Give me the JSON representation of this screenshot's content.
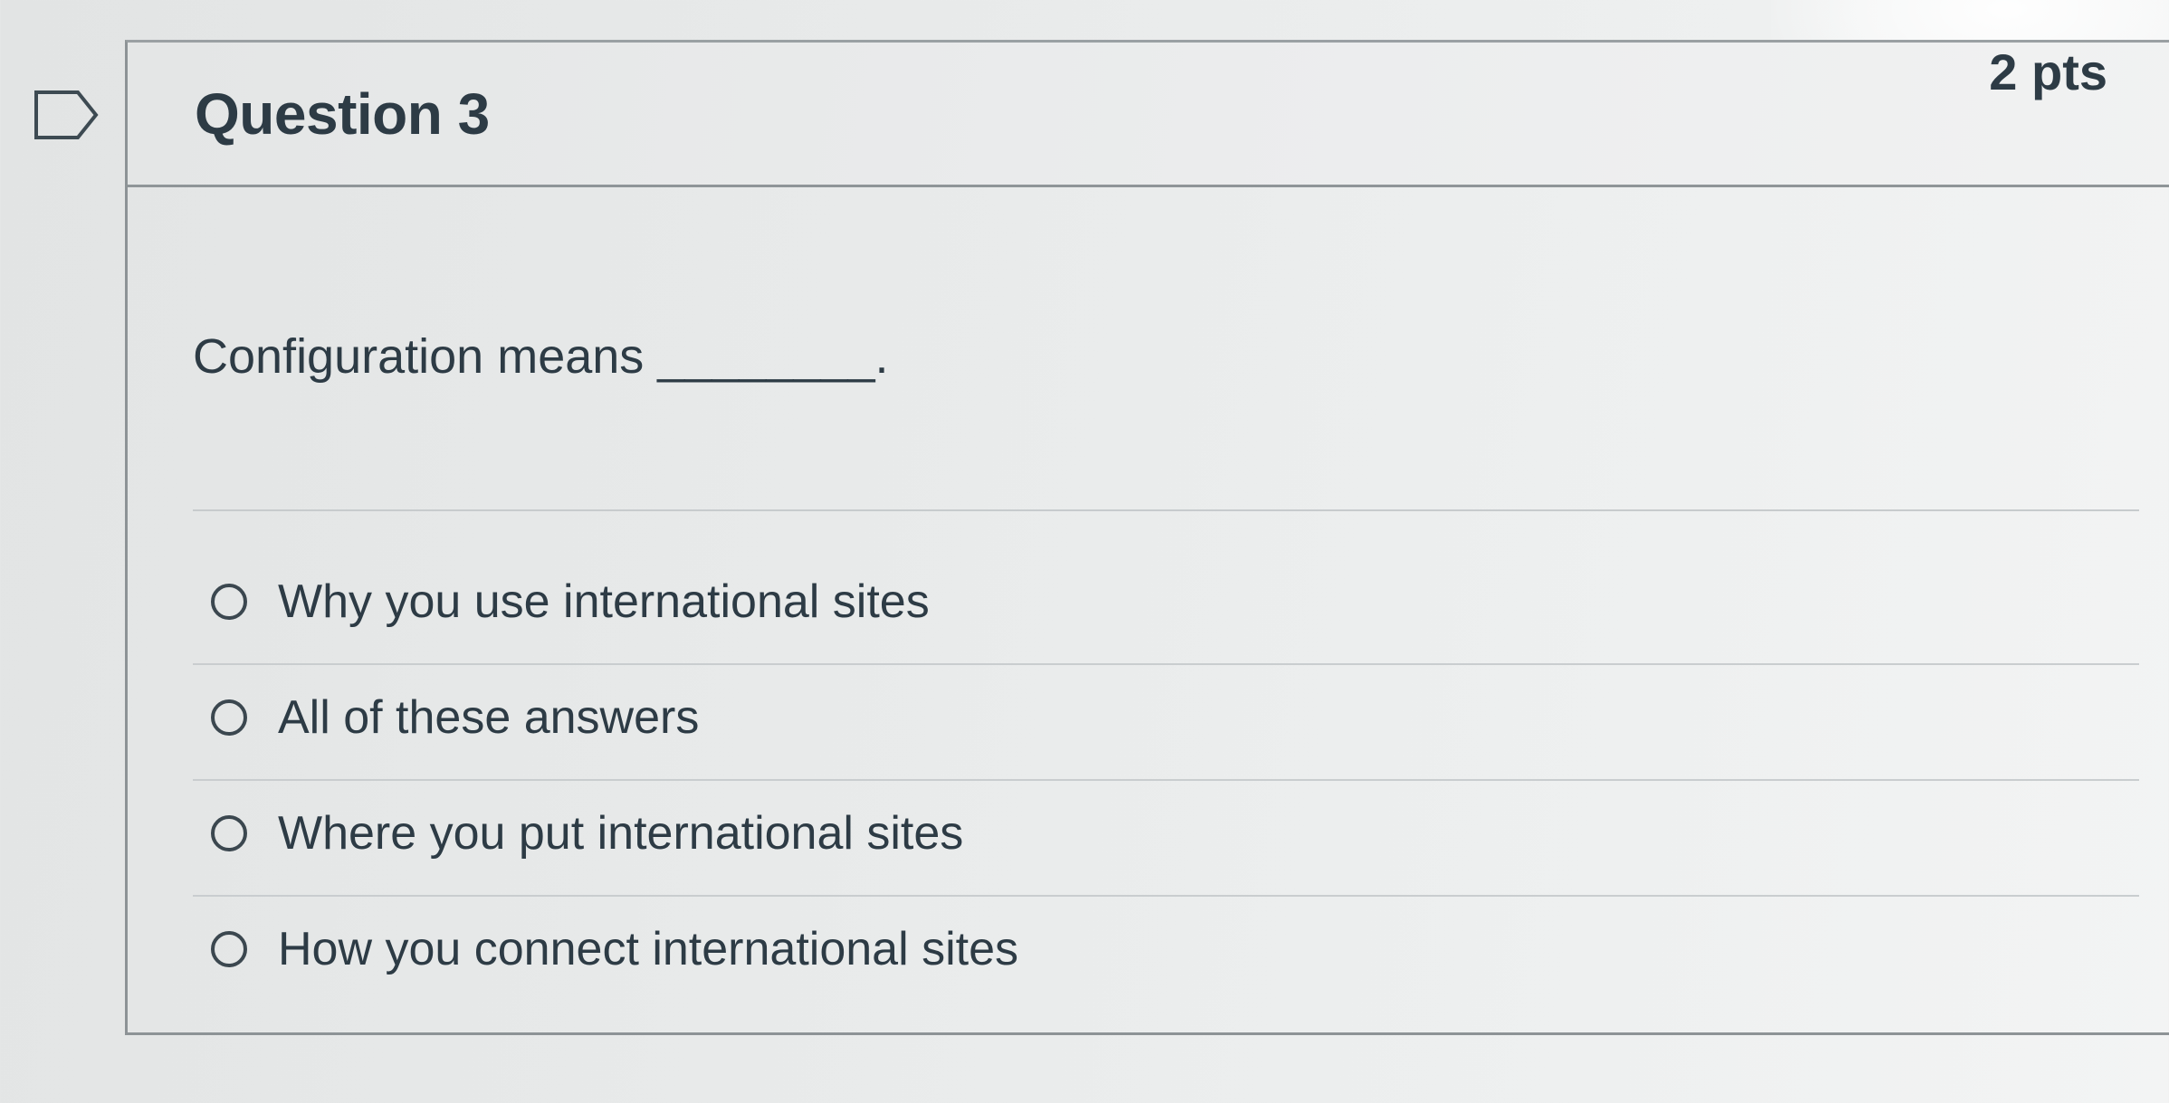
{
  "question": {
    "title": "Question 3",
    "points": "2 pts",
    "text": "Configuration means ________."
  },
  "answers": [
    {
      "label": "Why you use international sites"
    },
    {
      "label": "All of these answers"
    },
    {
      "label": "Where you put international sites"
    },
    {
      "label": "How you connect international sites"
    }
  ],
  "icons": {
    "flag": "flag-icon",
    "radio": "radio-unselected"
  }
}
